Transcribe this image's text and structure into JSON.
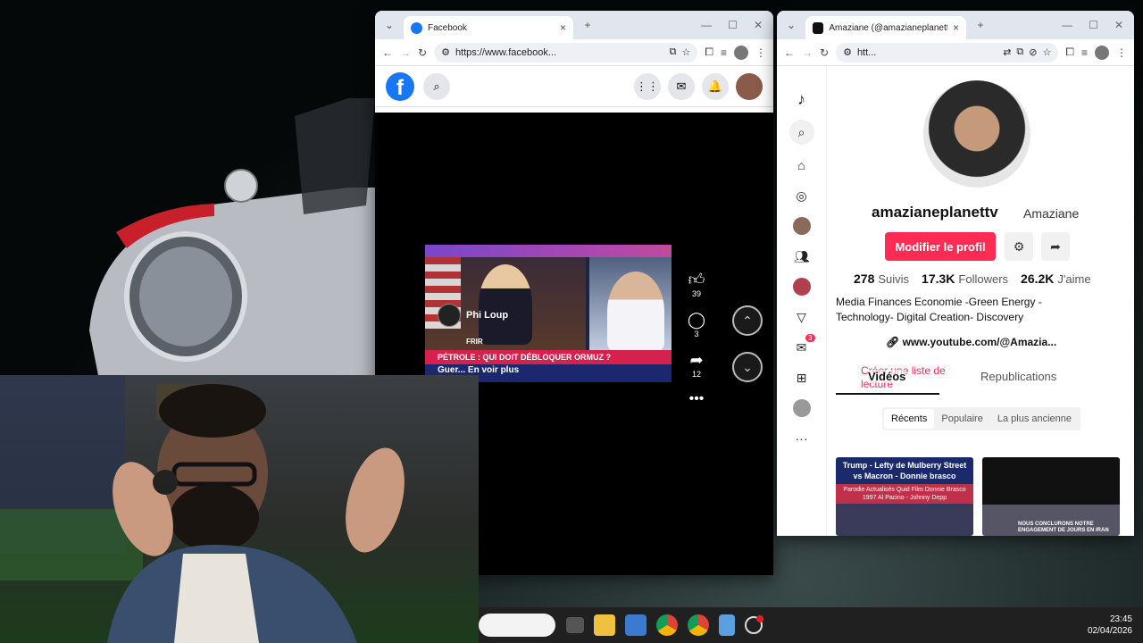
{
  "facebook_window": {
    "tab_title": "Facebook",
    "url": "https://www.facebook...",
    "post": {
      "channel_name": "Phi Loup",
      "ticker_text": "PÉTROLE : QUI DOIT DÉBLOQUER ORMUZ ?",
      "caption": "Guer... En voir plus",
      "tag": "FRIR"
    },
    "actions": {
      "likes": "39",
      "comments": "3",
      "shares": "12"
    }
  },
  "tiktok_window": {
    "tab_title": "Amaziane (@amazianeplanettv",
    "url": "htt...",
    "username": "amazianeplanettv",
    "nickname": "Amaziane",
    "edit_button": "Modifier le profil",
    "stats": [
      {
        "value": "278",
        "label": "Suivis"
      },
      {
        "value": "17.3K",
        "label": "Followers"
      },
      {
        "value": "26.2K",
        "label": "J'aime"
      }
    ],
    "bio": "Media Finances Economie -Green Energy - Technology- Digital Creation- Discovery",
    "link": "www.youtube.com/@Amazia...",
    "tabs": {
      "videos": "Vidéos",
      "playlist": "Créer une liste de lecture",
      "reposts": "Republications"
    },
    "sort_options": [
      "Récents",
      "Populaire",
      "La plus ancienne"
    ],
    "notification_count": "3",
    "thumbnails": [
      {
        "title": "Trump - Lefty de Mulberry Street vs Macron - Donnie brasco",
        "subtitle": "Parodie Actualisés Quid Film Donnie Brasco 1997 Al Pacino - Johnny Depp"
      },
      {
        "title": "NOUS CONCLURONS NOTRE ENGAGEMENT DE JOURS EN IRAN"
      }
    ]
  },
  "taskbar": {
    "time": "23:45",
    "date": "02/04/2026"
  },
  "colors": {
    "facebook_blue": "#1877f2",
    "tiktok_red": "#fe2c55",
    "ticker_red": "#d6204d"
  }
}
